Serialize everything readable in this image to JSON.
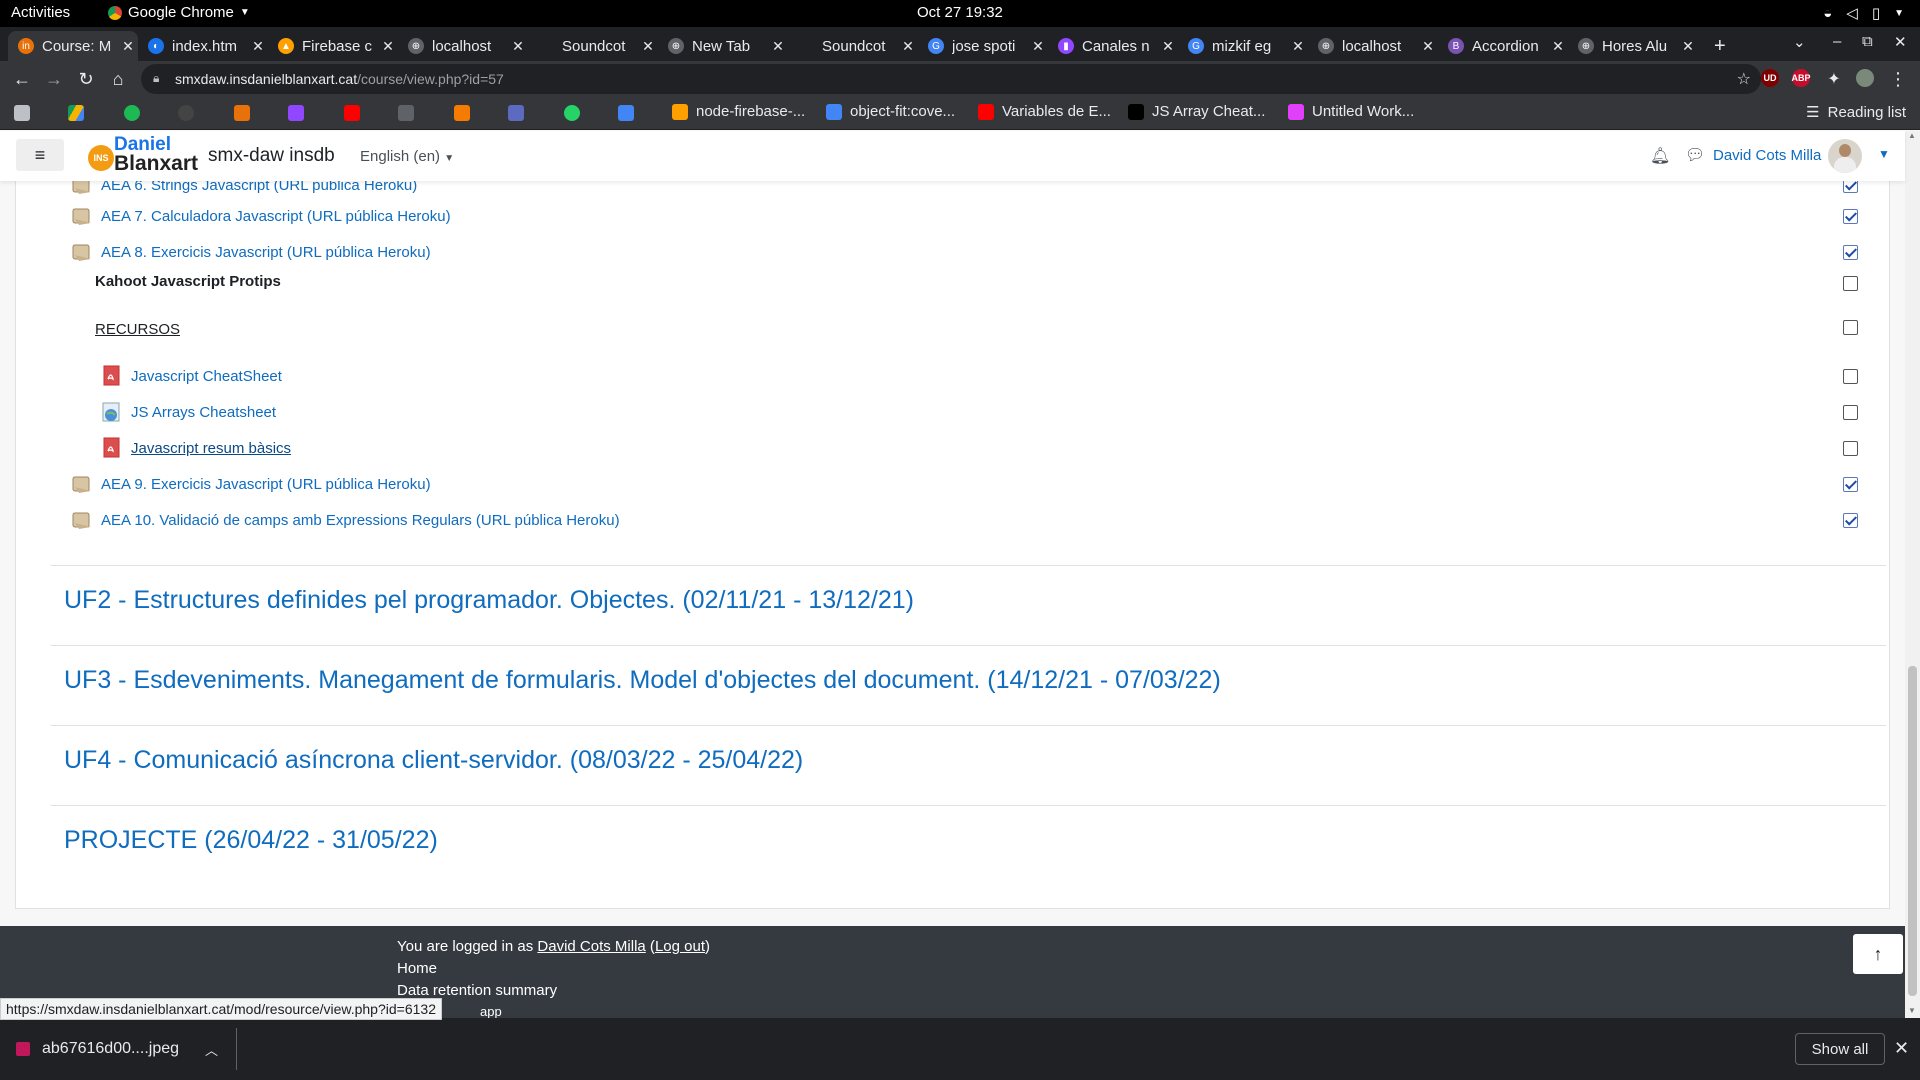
{
  "system": {
    "activities": "Activities",
    "app_name": "Google Chrome",
    "clock": "Oct 27  19:32"
  },
  "tabs": [
    {
      "label": "Course: M",
      "color": "#e8710a",
      "glyph": "in",
      "active": true
    },
    {
      "label": "index.htm",
      "color": "#1a73e8",
      "glyph": "◐"
    },
    {
      "label": "Firebase c",
      "color": "#ffa000",
      "glyph": "▲"
    },
    {
      "label": "localhost",
      "color": "#5f6368",
      "glyph": "⊕"
    },
    {
      "label": "Soundcot",
      "color": "#202124",
      "glyph": ""
    },
    {
      "label": "New Tab",
      "color": "#5f6368",
      "glyph": "⊕"
    },
    {
      "label": "Soundcot",
      "color": "#202124",
      "glyph": ""
    },
    {
      "label": "jose spoti",
      "color": "#4285f4",
      "glyph": "G"
    },
    {
      "label": "Canales n",
      "color": "#9146ff",
      "glyph": "▮"
    },
    {
      "label": "mizkif eg",
      "color": "#4285f4",
      "glyph": "G"
    },
    {
      "label": "localhost",
      "color": "#5f6368",
      "glyph": "⊕"
    },
    {
      "label": "Accordion",
      "color": "#7952b3",
      "glyph": "B"
    },
    {
      "label": "Hores Alu",
      "color": "#5f6368",
      "glyph": "⊕"
    }
  ],
  "toolbar": {
    "url_host": "smxdaw.insdanielblanxart.cat",
    "url_path": "/course/view.php?id=57",
    "ext_ud": "UD",
    "ext_abp": "ABP"
  },
  "bookmarks": [
    {
      "label": "node-firebase-...",
      "color": "#ffa000"
    },
    {
      "label": "object-fit:cove...",
      "color": "#4285f4"
    },
    {
      "label": "Variables de E...",
      "color": "#ff0000"
    },
    {
      "label": "JS Array Cheat...",
      "color": "#000000"
    },
    {
      "label": "Untitled Work...",
      "color": "#e040fb"
    }
  ],
  "reading_list": "Reading list",
  "moodle": {
    "site_name": "smx-daw insdb",
    "logo_top": "Daniel",
    "logo_bottom": "Blanxart",
    "logo_badge": "INS",
    "language": "English (en)",
    "user_name": "David Cots Milla"
  },
  "activities_list": [
    {
      "label": "AEA 6. Strings Javascript (URL pública Heroku)",
      "type": "assign",
      "checked": true
    },
    {
      "label": "AEA 7. Calculadora Javascript (URL pública Heroku)",
      "type": "assign",
      "checked": true
    },
    {
      "label": "AEA 8. Exercicis Javascript (URL pública Heroku)",
      "type": "assign",
      "checked": true
    },
    {
      "label": "Kahoot Javascript Protips",
      "type": "label-bold",
      "checked": false
    },
    {
      "label": "RECURSOS",
      "type": "label-underline",
      "checked": false
    },
    {
      "label": "Javascript CheatSheet",
      "type": "pdf",
      "checked": false
    },
    {
      "label": "JS Arrays Cheatsheet",
      "type": "url",
      "checked": false
    },
    {
      "label": "Javascript resum bàsics",
      "type": "pdf-hover",
      "checked": false
    },
    {
      "label": "AEA 9. Exercicis Javascript (URL pública Heroku)",
      "type": "assign",
      "checked": true
    },
    {
      "label": "AEA 10. Validació de camps amb Expressions Regulars (URL pública Heroku)",
      "type": "assign",
      "checked": true
    }
  ],
  "sections": [
    "UF2 - Estructures definides pel programador. Objectes. (02/11/21 - 13/12/21)",
    "UF3 - Esdeveniments. Manegament de formularis. Model d'objectes del document. (14/12/21 - 07/03/22)",
    "UF4 - Comunicació asíncrona client-servidor. (08/03/22 - 25/04/22)",
    "PROJECTE (26/04/22 - 31/05/22)"
  ],
  "footer": {
    "logged_prefix": "You are logged in as ",
    "logged_user": "David Cots Milla",
    "logout": "Log out",
    "home": "Home",
    "data_retention": "Data retention summary",
    "partial_line": "app"
  },
  "status_url": "https://smxdaw.insdanielblanxart.cat/mod/resource/view.php?id=6132",
  "download": {
    "file": "ab67616d00....jpeg",
    "show_all": "Show all"
  }
}
